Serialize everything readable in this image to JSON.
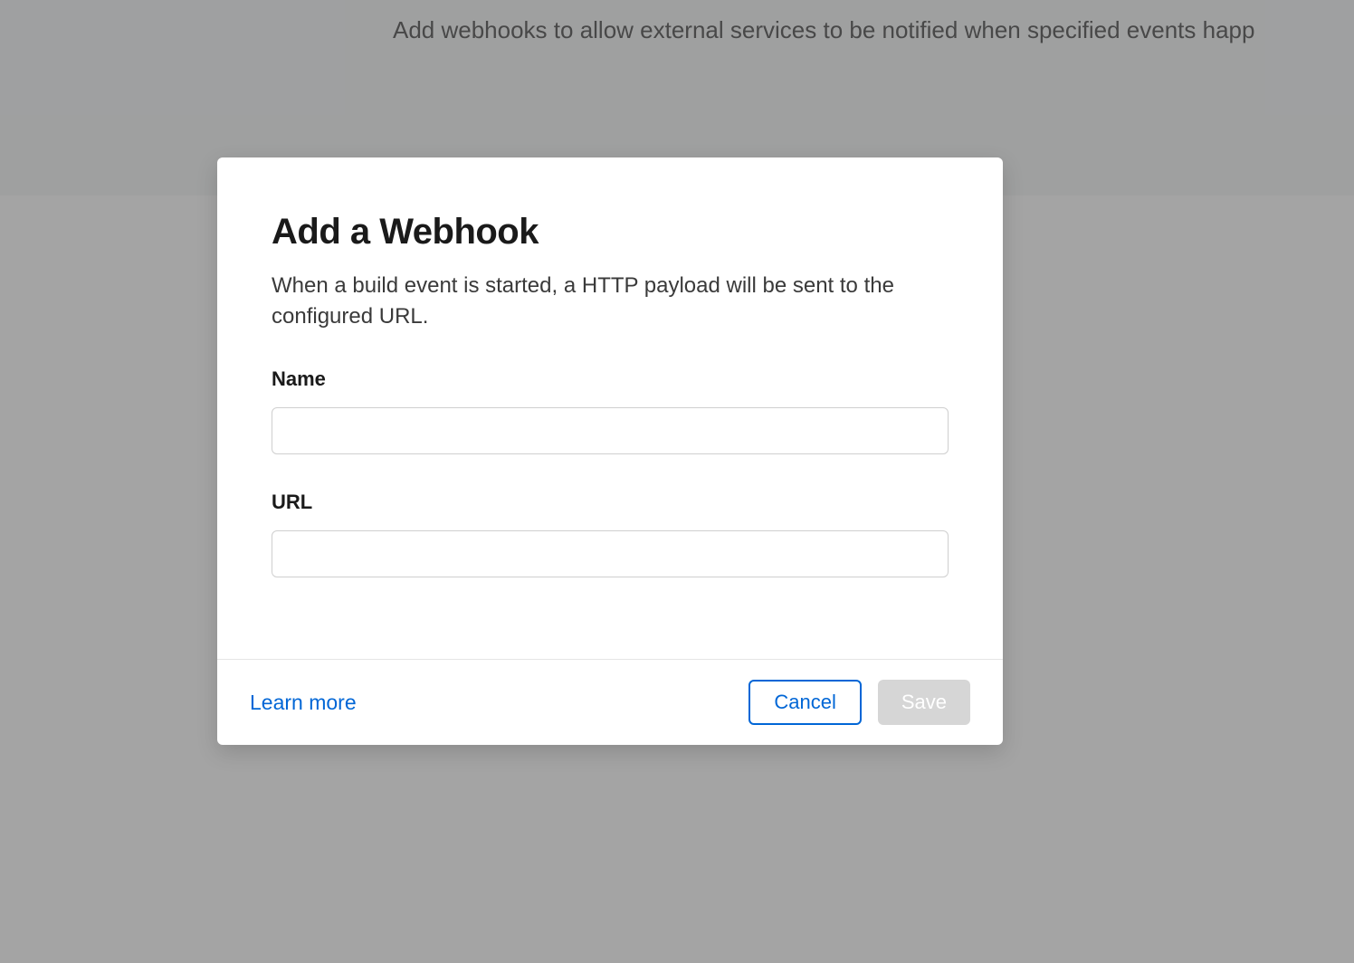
{
  "background": {
    "description": "Add webhooks to allow external services to be notified when specified events happ"
  },
  "modal": {
    "title": "Add a Webhook",
    "description": "When a build event is started, a HTTP payload will be sent to the configured URL.",
    "fields": {
      "name": {
        "label": "Name",
        "value": ""
      },
      "url": {
        "label": "URL",
        "value": ""
      }
    },
    "footer": {
      "learn_more": "Learn more",
      "cancel": "Cancel",
      "save": "Save"
    }
  }
}
